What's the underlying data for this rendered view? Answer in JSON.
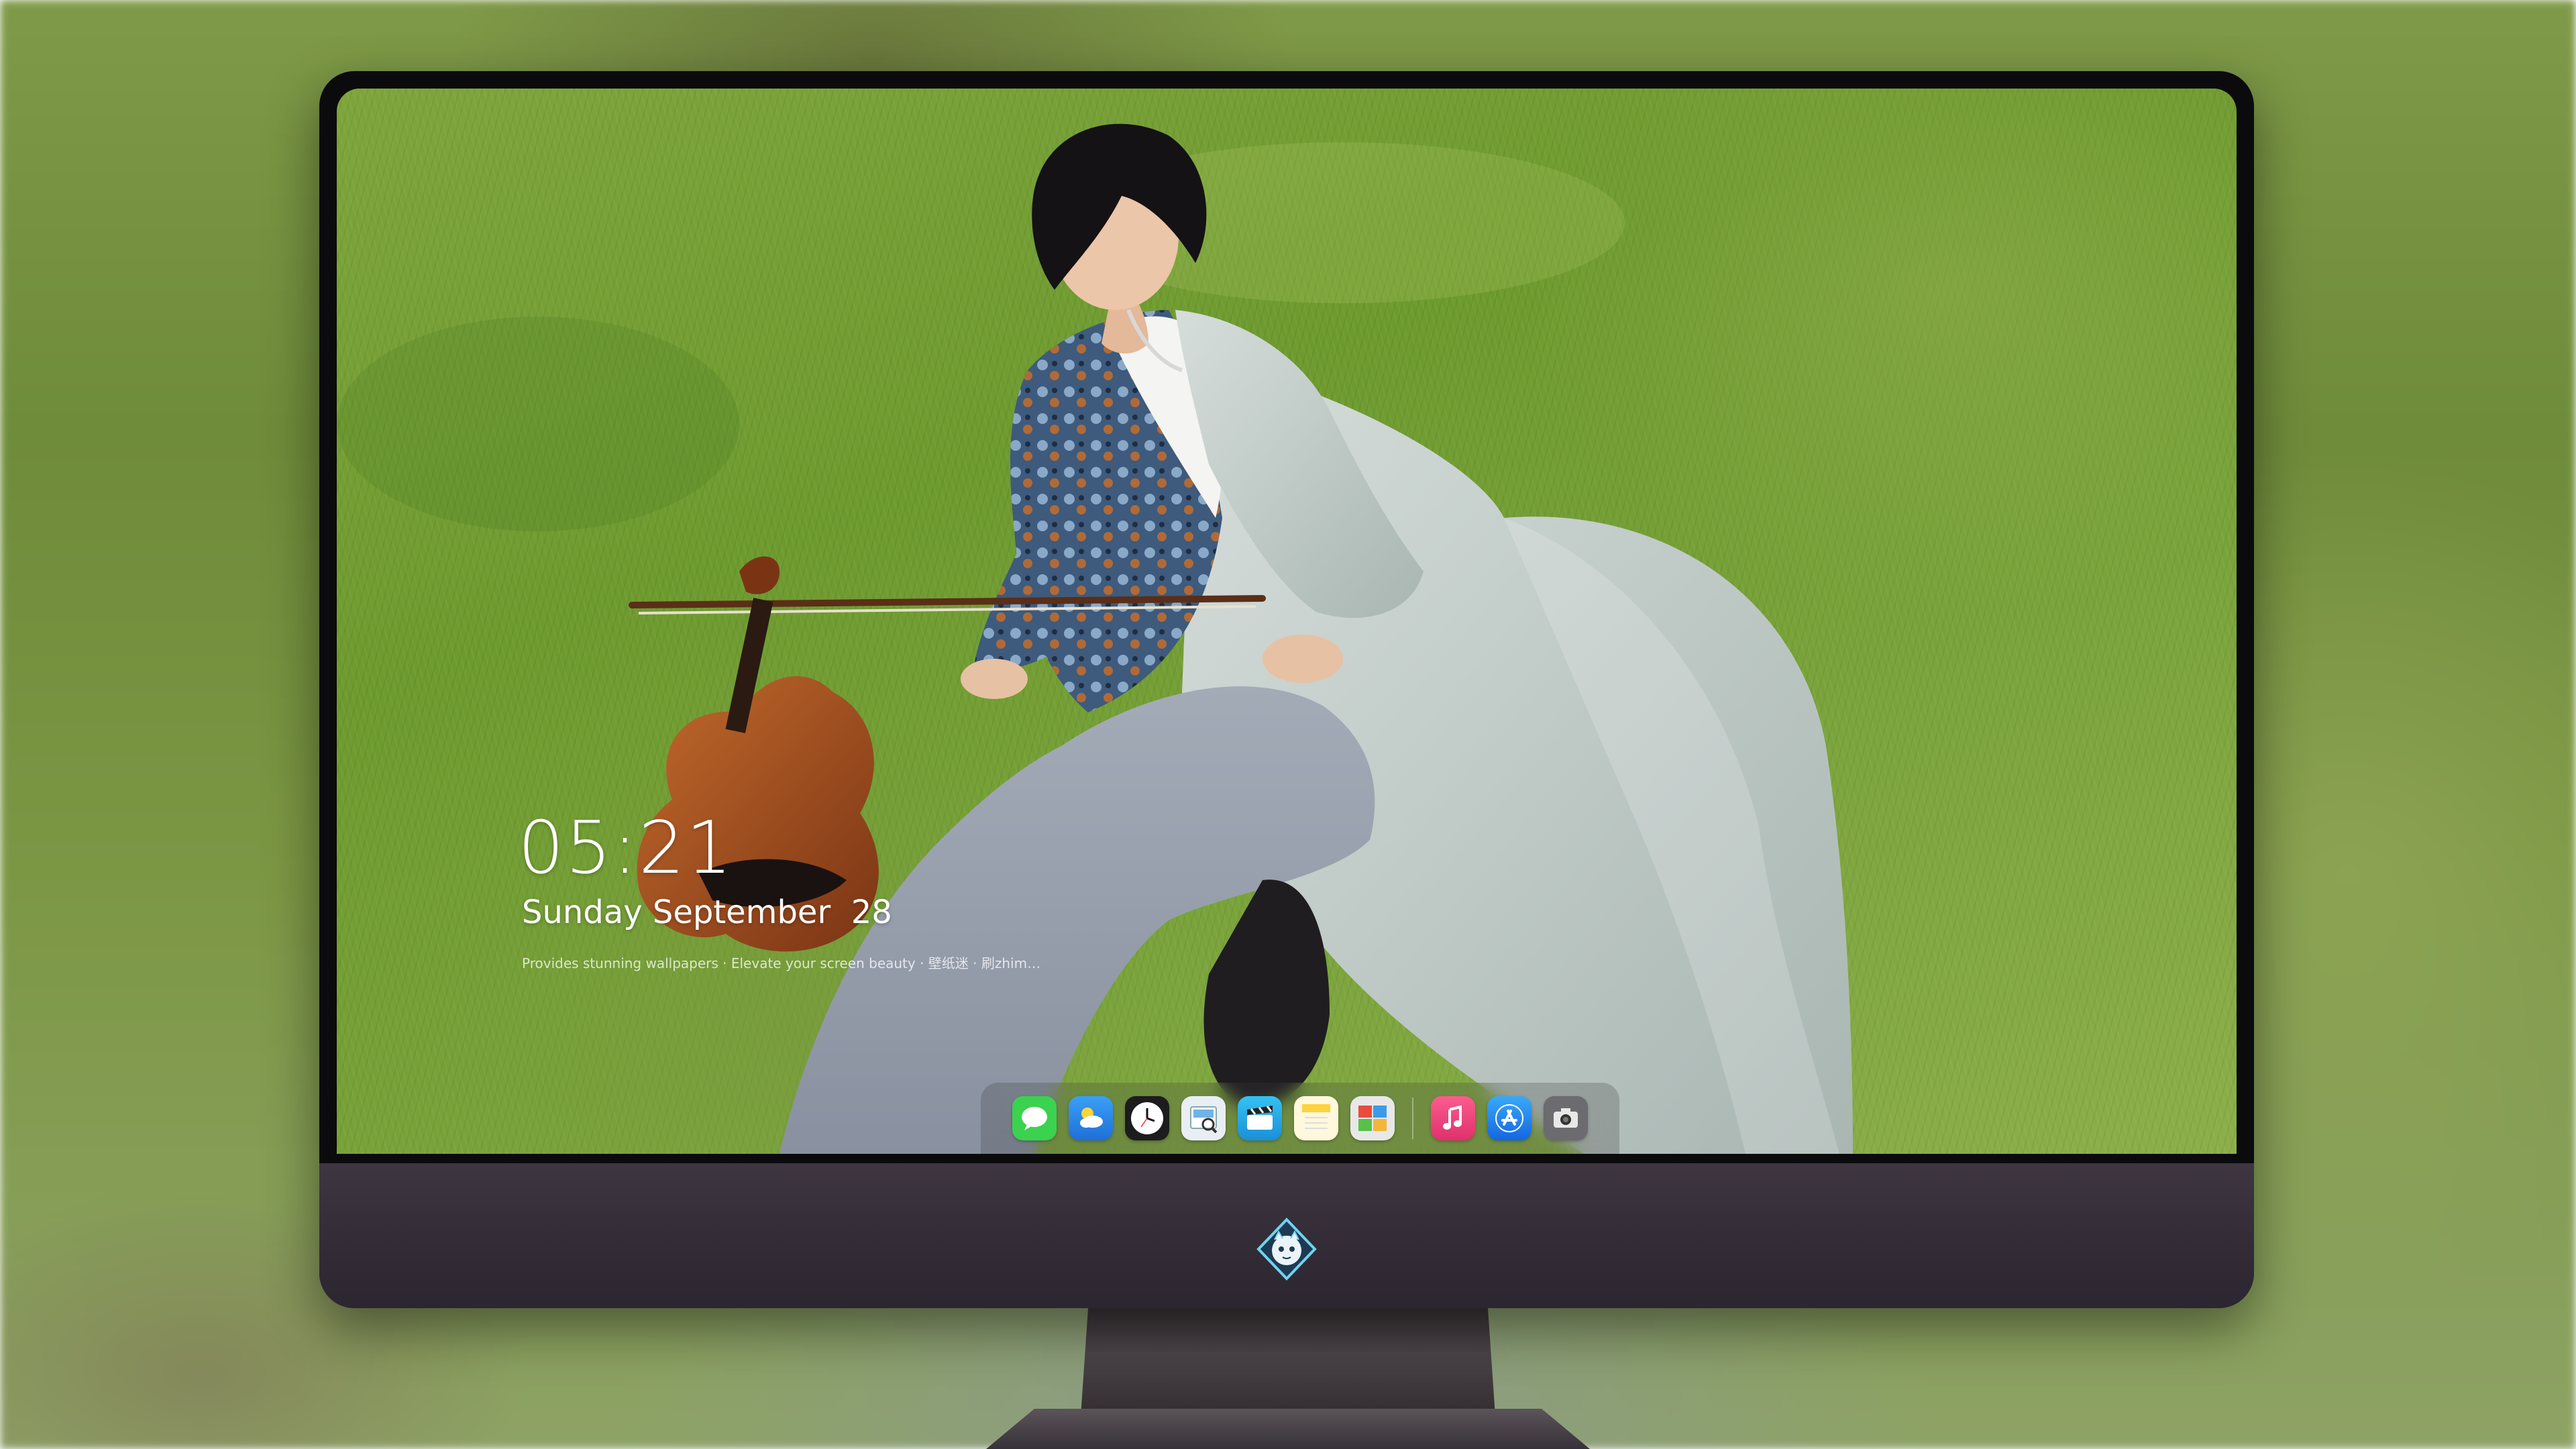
{
  "lockscreen": {
    "time": "05:21",
    "date": "Sunday September  28",
    "tagline": "Provides stunning wallpapers · Elevate your screen beauty · 壁纸迷 · 刷zhim…"
  },
  "dock": {
    "apps": [
      {
        "name": "Messages",
        "icon": "messages-icon",
        "color": "#3ad24f"
      },
      {
        "name": "Weather",
        "icon": "weather-icon",
        "color": "#2f8ef0"
      },
      {
        "name": "Clock",
        "icon": "clock-icon",
        "color": "#1c1c1e"
      },
      {
        "name": "Preview",
        "icon": "preview-icon",
        "color": "#e9eef5"
      },
      {
        "name": "Clips",
        "icon": "clips-icon",
        "color": "#2bb3f0"
      },
      {
        "name": "Notes",
        "icon": "notes-icon",
        "color": "#ffd23c"
      },
      {
        "name": "Photo Booth",
        "icon": "photo-booth-icon",
        "color": "#e8e8e8"
      },
      {
        "name": "Music",
        "icon": "music-icon",
        "color": "#f24d8a"
      },
      {
        "name": "App Store",
        "icon": "app-store-icon",
        "color": "#1f8cf5"
      },
      {
        "name": "Camera",
        "icon": "camera-icon",
        "color": "#6b6b70"
      }
    ]
  },
  "monitor": {
    "logo": "mascot-logo-icon",
    "chin_color": "#3a3240"
  }
}
